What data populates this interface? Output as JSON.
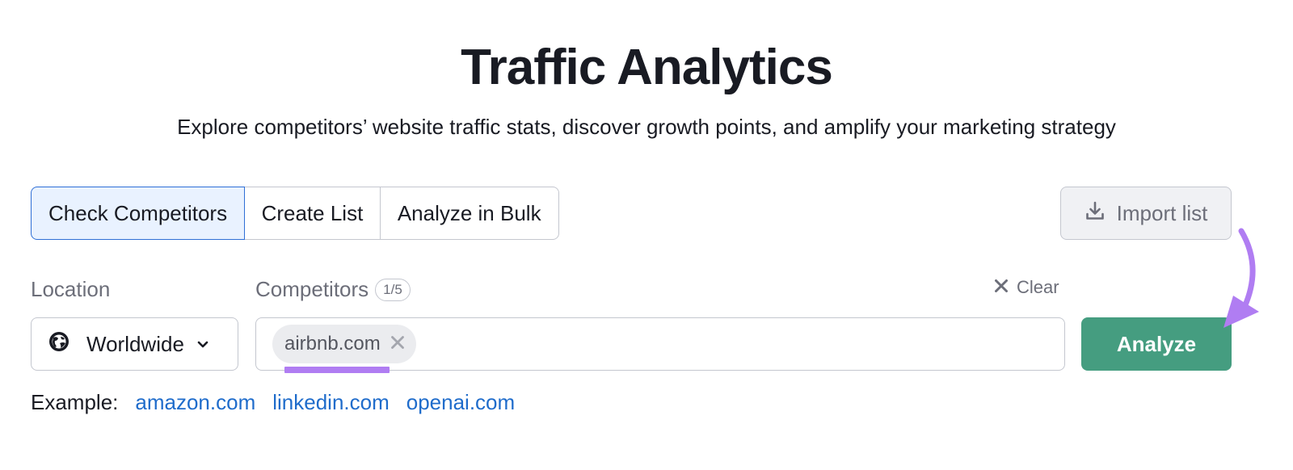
{
  "header": {
    "title": "Traffic Analytics",
    "subtitle": "Explore competitors’ website traffic stats, discover growth points, and amplify your marketing strategy"
  },
  "tabs": [
    {
      "label": "Check Competitors",
      "active": true
    },
    {
      "label": "Create List",
      "active": false
    },
    {
      "label": "Analyze in Bulk",
      "active": false
    }
  ],
  "import_button": {
    "label": "Import list",
    "icon": "download-icon"
  },
  "location": {
    "label": "Location",
    "selected": "Worldwide",
    "icon": "globe-icon"
  },
  "competitors": {
    "label": "Competitors",
    "count": "1/5",
    "clear_label": "Clear",
    "chips": [
      {
        "label": "airbnb.com"
      }
    ]
  },
  "analyze_button": {
    "label": "Analyze"
  },
  "examples": {
    "label": "Example:",
    "links": [
      "amazon.com",
      "linkedin.com",
      "openai.com"
    ]
  },
  "colors": {
    "accent_green": "#459d80",
    "link_blue": "#1f6ccb",
    "active_tab_bg": "#e9f2ff",
    "annotation_purple": "#b07df2"
  }
}
